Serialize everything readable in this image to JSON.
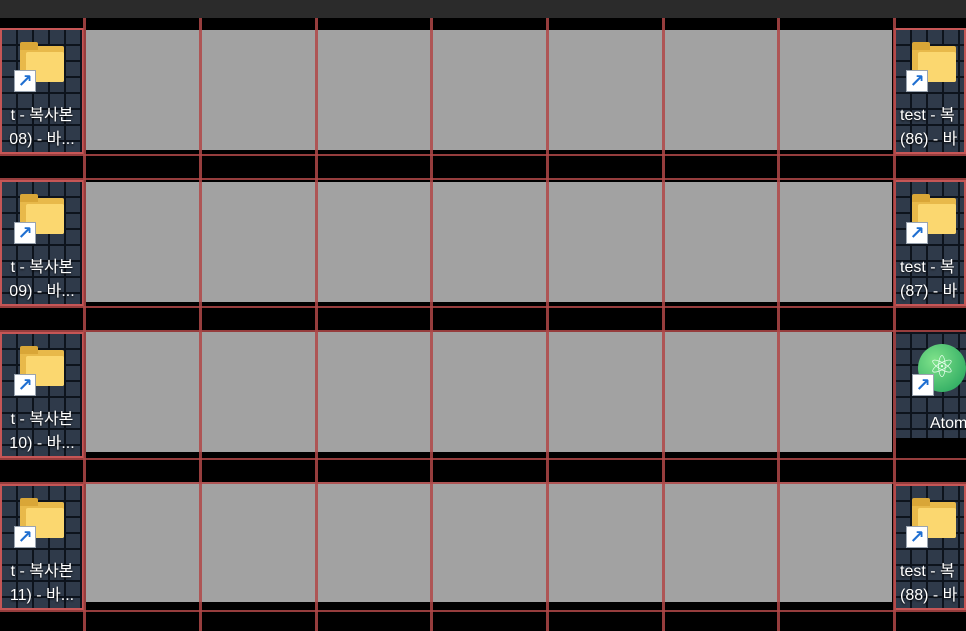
{
  "window": {
    "title": ""
  },
  "rows": [
    {
      "left": {
        "type": "folder",
        "line1": "t - 복사본",
        "line2": "08) - 바..."
      },
      "right": {
        "type": "folder",
        "line1": "test - 복",
        "line2": "(86) - 바"
      }
    },
    {
      "left": {
        "type": "folder",
        "line1": "t - 복사본",
        "line2": "09) - 바..."
      },
      "right": {
        "type": "folder",
        "line1": "test - 복",
        "line2": "(87) - 바"
      }
    },
    {
      "left": {
        "type": "folder",
        "line1": "t - 복사본",
        "line2": "10) - 바..."
      },
      "right": {
        "type": "app",
        "line1": "Atom",
        "line2": ""
      }
    },
    {
      "left": {
        "type": "folder",
        "line1": "t - 복사본",
        "line2": "11) - 바..."
      },
      "right": {
        "type": "folder",
        "line1": "test - 복",
        "line2": "(88) - 바"
      }
    }
  ],
  "icons": {
    "folder": "folder-shortcut-icon",
    "atom": "atom-app-icon",
    "shortcut": "shortcut-arrow-icon"
  },
  "colors": {
    "desktop": "#2f3a4a",
    "grid": "#0d131c",
    "selection": "#c65656",
    "overlay": "#a2a2a2",
    "folder": "#fbd76f"
  }
}
